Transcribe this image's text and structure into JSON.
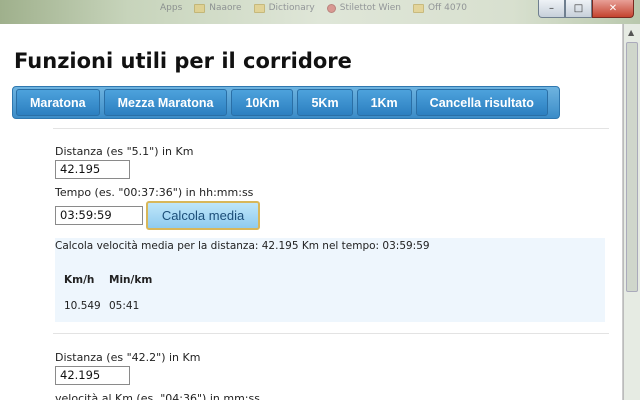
{
  "browser": {
    "bookmarks": [
      "Apps",
      "Naaore",
      "Dictionary",
      "Stilettot Wien",
      "Off 4070"
    ],
    "window_controls": {
      "minimize": "–",
      "maximize": "□",
      "close": "✕"
    }
  },
  "page": {
    "title": "Funzioni utili per il corridore",
    "tabs": [
      "Maratona",
      "Mezza Maratona",
      "10Km",
      "5Km",
      "1Km",
      "Cancella risultato"
    ]
  },
  "form1": {
    "distance_label": "Distanza (es \"5.1\") in Km",
    "distance_value": "42.195",
    "time_label": "Tempo (es. \"00:37:36\") in hh:mm:ss",
    "time_value": "03:59:59",
    "calc_button": "Calcola media"
  },
  "result": {
    "text": "Calcola velocità  media per la distanza: 42.195 Km nel tempo: 03:59:59",
    "headers": [
      "Km/h",
      "Min/km"
    ],
    "values": [
      "10.549",
      "05:41"
    ]
  },
  "form2": {
    "distance_label": "Distanza (es \"42.2\") in Km",
    "distance_value": "42.195",
    "speed_label": "velocità al Km (es. \"04:36\") in mm:ss"
  },
  "colors": {
    "tab_bar": "#3b8cc8",
    "calc_button": "#8fcbee",
    "result_bg": "#eef6fd"
  }
}
